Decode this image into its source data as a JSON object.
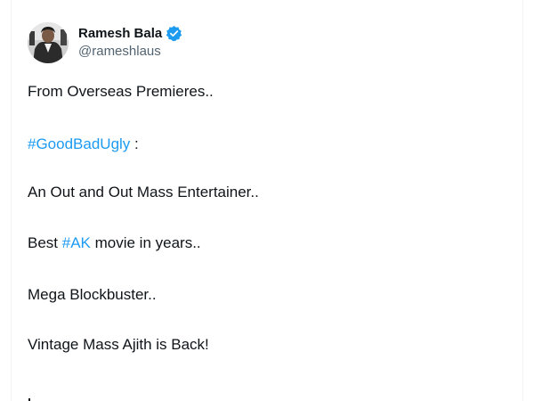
{
  "tweet": {
    "author": {
      "display_name": "Ramesh Bala",
      "handle": "@rameshlaus",
      "verified": true,
      "verified_color": "#1d9bf0",
      "avatar_icon": "avatar-photo"
    },
    "lines": {
      "l1": "From Overseas Premieres..",
      "l2_tag": "#GoodBadUgly",
      "l2_rest": " :",
      "l3": "An Out and Out Mass Entertainer..",
      "l4_pre": "Best ",
      "l4_tag": "#AK",
      "l4_rest": " movie in years..",
      "l5": "Mega Blockbuster..",
      "l6": "Vintage Mass Ajith is Back!"
    },
    "link_color": "#1d9bf0",
    "text_color": "#0f1419",
    "secondary_color": "#536471"
  }
}
